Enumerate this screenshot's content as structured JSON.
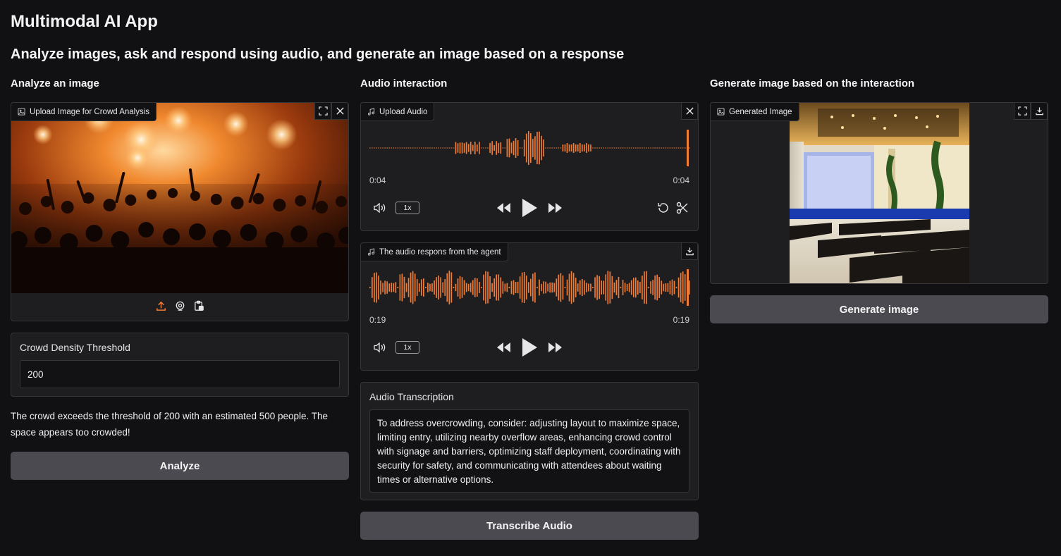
{
  "app": {
    "title": "Multimodal AI App",
    "subtitle": "Analyze images, ask and respond using audio, and generate an image based on a response"
  },
  "columns": {
    "analyze_title": "Analyze an image",
    "audio_title": "Audio interaction",
    "generate_title": "Generate image based on the interaction"
  },
  "image_upload": {
    "label": "Upload Image for Crowd Analysis",
    "label_icon": "image-icon",
    "actions": [
      "upload-icon",
      "webcam-icon",
      "clipboard-icon"
    ]
  },
  "threshold": {
    "label": "Crowd Density Threshold",
    "value": "200"
  },
  "analysis_result": "The crowd exceeds the threshold of 200 with an estimated 500 people. The space appears too crowded!",
  "analyze_button": "Analyze",
  "upload_audio": {
    "label": "Upload Audio",
    "label_icon": "music-icon",
    "time_current": "0:04",
    "time_total": "0:04",
    "speed": "1x"
  },
  "response_audio": {
    "label": "The audio respons from the agent",
    "label_icon": "music-icon",
    "time_current": "0:19",
    "time_total": "0:19",
    "speed": "1x"
  },
  "transcription": {
    "label": "Audio Transcription",
    "text": "To address overcrowding, consider: adjusting layout to maximize space, limiting entry, utilizing nearby overflow areas, enhancing crowd control with signage and barriers, optimizing staff deployment, coordinating with security for safety, and communicating with attendees about waiting times or alternative options."
  },
  "transcribe_button": "Transcribe Audio",
  "generated_image": {
    "label": "Generated Image",
    "label_icon": "image-icon"
  },
  "generate_button": "Generate image",
  "colors": {
    "background": "#111113",
    "panel": "#1e1e21",
    "accent": "#f07c35",
    "button": "#4a4a50"
  }
}
